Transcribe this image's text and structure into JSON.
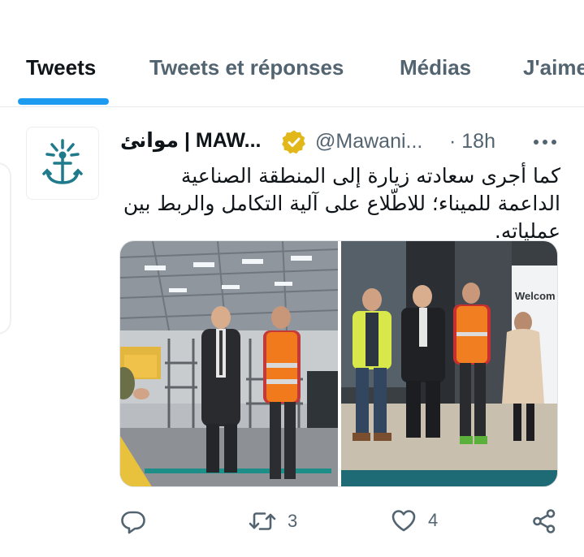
{
  "tabs": [
    {
      "label": "Tweets",
      "active": true
    },
    {
      "label": "Tweets et réponses",
      "active": false
    },
    {
      "label": "Médias",
      "active": false
    },
    {
      "label": "J'aime",
      "active": false
    }
  ],
  "tweet": {
    "display_name": "موانئ | MAW...",
    "handle": "@Mawani...",
    "time": "· 18h",
    "text": "كما أجرى سعادته زيارة إلى المنطقة الصناعية الداعمة للميناء؛ للاطّلاع على آلية التكامل والربط بين عملياته.",
    "media": {
      "right_photo_sign": "Welcom"
    },
    "actions": {
      "reply_count": "",
      "retweet_count": "3",
      "like_count": "4"
    }
  },
  "colors": {
    "accent": "#1d9bf0",
    "verified_gold": "#e2b719",
    "brand_teal": "#1f7a8c",
    "muted_text": "#536471"
  },
  "icons": [
    "anchor-logo-icon",
    "verified-badge-icon",
    "more-icon",
    "reply-icon",
    "retweet-icon",
    "like-icon",
    "share-icon"
  ]
}
